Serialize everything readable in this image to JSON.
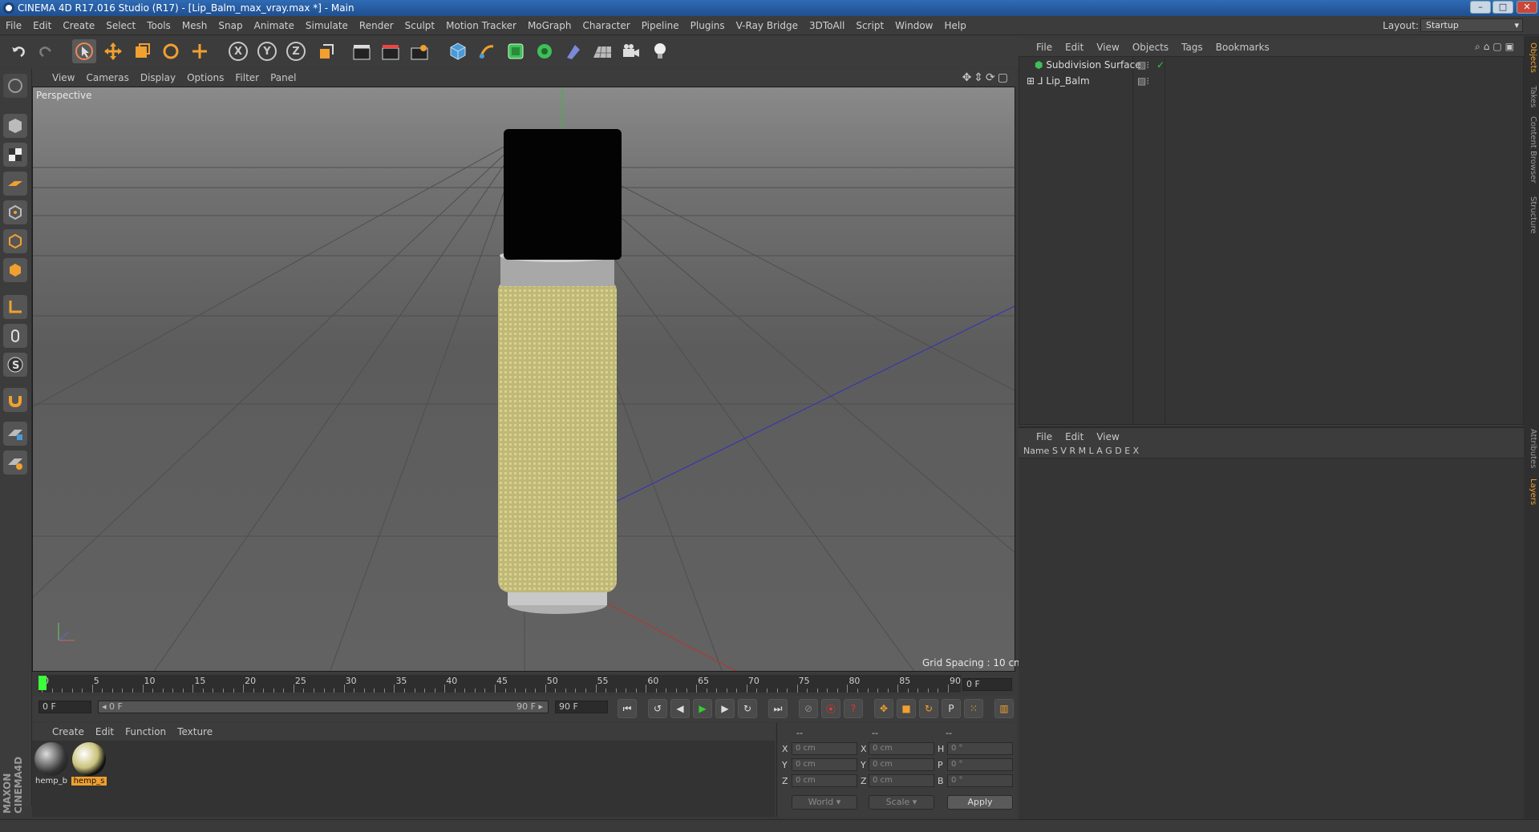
{
  "app": {
    "title": "CINEMA 4D R17.016 Studio (R17) - [Lip_Balm_max_vray.max *] - Main",
    "window_controls": [
      "–",
      "□",
      "✕"
    ]
  },
  "menu": [
    "File",
    "Edit",
    "Create",
    "Select",
    "Tools",
    "Mesh",
    "Snap",
    "Animate",
    "Simulate",
    "Render",
    "Sculpt",
    "Motion Tracker",
    "MoGraph",
    "Character",
    "Pipeline",
    "Plugins",
    "V-Ray Bridge",
    "3DToAll",
    "Script",
    "Window",
    "Help"
  ],
  "layout": {
    "label": "Layout:",
    "value": "Startup"
  },
  "toolbar": {
    "x_label": "X",
    "y_label": "Y",
    "z_label": "Z"
  },
  "viewport": {
    "menu": [
      "View",
      "Cameras",
      "Display",
      "Options",
      "Filter",
      "Panel"
    ],
    "label": "Perspective",
    "grid_spacing": "Grid Spacing : 10 cm"
  },
  "timeline": {
    "ticks": [
      "0",
      "5",
      "10",
      "15",
      "20",
      "25",
      "30",
      "35",
      "40",
      "45",
      "50",
      "55",
      "60",
      "65",
      "70",
      "75",
      "80",
      "85",
      "90"
    ],
    "current_frame": "0 F",
    "start_field": "0 F",
    "range_start": "◂ 0 F",
    "range_end": "90 F ▸",
    "end_field": "90 F"
  },
  "materials": {
    "menu": [
      "Create",
      "Edit",
      "Function",
      "Texture"
    ],
    "items": [
      {
        "label": "hemp_b"
      },
      {
        "label": "hemp_s"
      }
    ]
  },
  "coords": {
    "header": [
      "--",
      "--",
      "--"
    ],
    "rows": [
      {
        "a": "X",
        "va": "0 cm",
        "b": "X",
        "vb": "0 cm",
        "c": "H",
        "vc": "0 °"
      },
      {
        "a": "Y",
        "va": "0 cm",
        "b": "Y",
        "vb": "0 cm",
        "c": "P",
        "vc": "0 °"
      },
      {
        "a": "Z",
        "va": "0 cm",
        "b": "Z",
        "vb": "0 cm",
        "c": "B",
        "vc": "0 °"
      }
    ],
    "world": "World",
    "scale": "Scale",
    "apply": "Apply"
  },
  "objects": {
    "menu": [
      "File",
      "Edit",
      "View",
      "Objects",
      "Tags",
      "Bookmarks"
    ],
    "items": [
      {
        "name": "Subdivision Surface"
      },
      {
        "name": "Lip_Balm"
      }
    ]
  },
  "layers": {
    "menu": [
      "File",
      "Edit",
      "View"
    ],
    "header": "Name    S V R M L A G D E X"
  },
  "side_tabs": [
    "Objects",
    "Takes",
    "Content Browser",
    "Structure",
    "Attributes",
    "Layers"
  ],
  "brand": "MAXON CINEMA4D"
}
